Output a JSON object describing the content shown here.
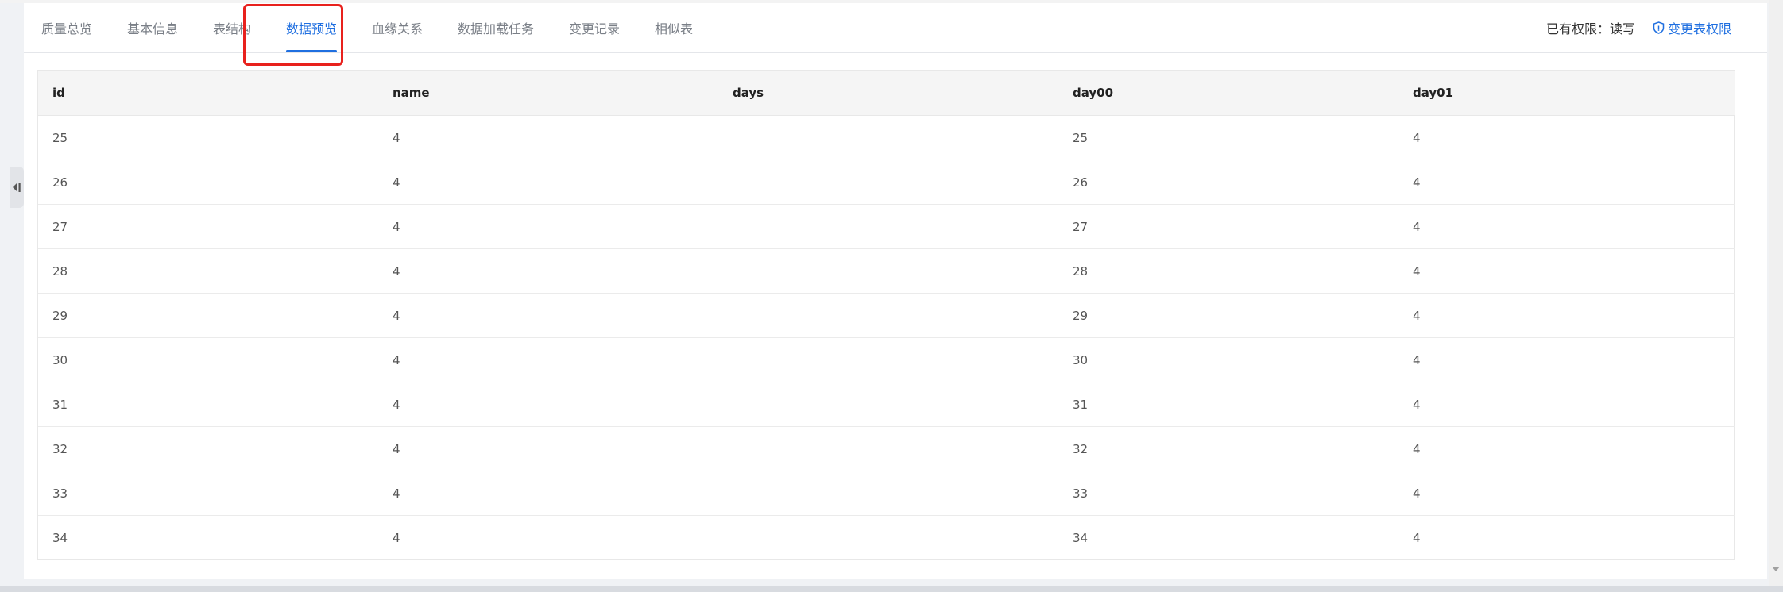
{
  "tabs": [
    {
      "label": "质量总览"
    },
    {
      "label": "基本信息"
    },
    {
      "label": "表结构"
    },
    {
      "label": "数据预览"
    },
    {
      "label": "血缘关系"
    },
    {
      "label": "数据加载任务"
    },
    {
      "label": "变更记录"
    },
    {
      "label": "相似表"
    }
  ],
  "active_tab": "数据预览",
  "permission": {
    "label": "已有权限：读写",
    "change_link": "变更表权限",
    "icon": "shield-icon"
  },
  "table": {
    "columns": [
      "id",
      "name",
      "days",
      "day00",
      "day01"
    ],
    "rows": [
      [
        "25",
        "4",
        "",
        "25",
        "4"
      ],
      [
        "26",
        "4",
        "",
        "26",
        "4"
      ],
      [
        "27",
        "4",
        "",
        "27",
        "4"
      ],
      [
        "28",
        "4",
        "",
        "28",
        "4"
      ],
      [
        "29",
        "4",
        "",
        "29",
        "4"
      ],
      [
        "30",
        "4",
        "",
        "30",
        "4"
      ],
      [
        "31",
        "4",
        "",
        "31",
        "4"
      ],
      [
        "32",
        "4",
        "",
        "32",
        "4"
      ],
      [
        "33",
        "4",
        "",
        "33",
        "4"
      ],
      [
        "34",
        "4",
        "",
        "34",
        "4"
      ]
    ]
  },
  "colors": {
    "accent": "#1f6fe0",
    "highlight_box": "#e8211d"
  }
}
